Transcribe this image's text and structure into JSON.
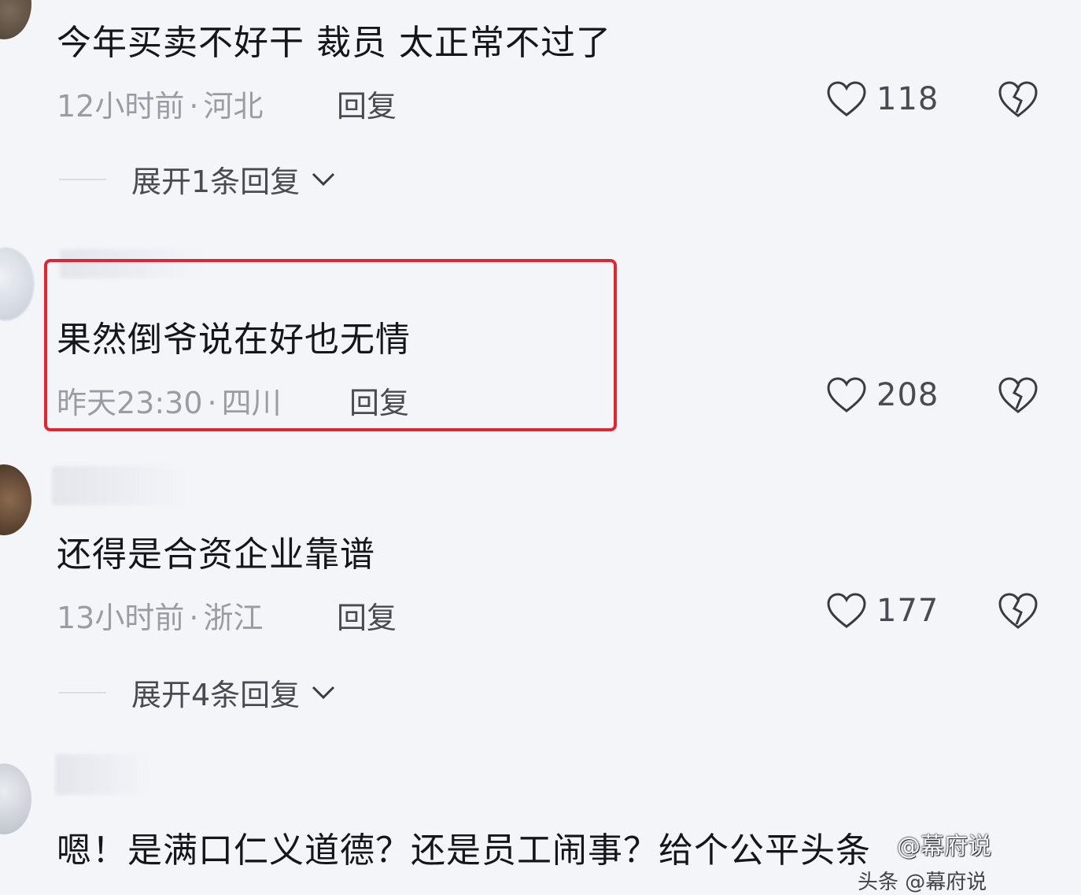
{
  "comments": [
    {
      "text": "今年买卖不好干 裁员 太正常不过了",
      "time": "12小时前",
      "location": "河北",
      "reply_label": "回复",
      "likes": "118",
      "expand_label": "展开1条回复"
    },
    {
      "text": "果然倒爷说在好也无情",
      "time": "昨天23:30",
      "location": "四川",
      "reply_label": "回复",
      "likes": "208"
    },
    {
      "text": "还得是合资企业靠谱",
      "time": "13小时前",
      "location": "浙江",
      "reply_label": "回复",
      "likes": "177",
      "expand_label": "展开4条回复"
    },
    {
      "text": "嗯！是满口仁义道德？还是员工闹事？给个公平头条"
    }
  ],
  "separator": "·",
  "watermark": "@幕府说",
  "watermark_bottom": "头条 @幕府说",
  "colors": {
    "highlight": "#e3252f",
    "background": "#f4f5f9"
  }
}
